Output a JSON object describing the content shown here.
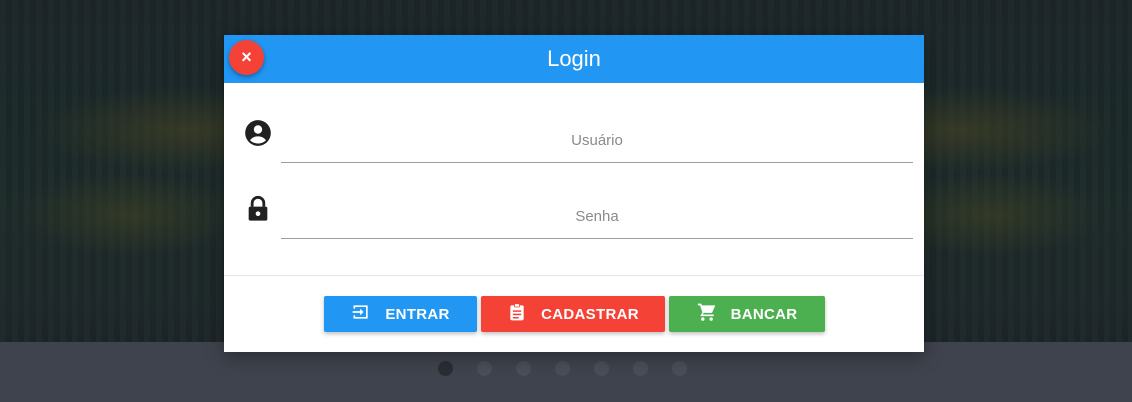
{
  "modal": {
    "title": "Login",
    "close_label": "×",
    "username_placeholder": "Usuário",
    "password_placeholder": "Senha"
  },
  "actions": {
    "entrar_label": "ENTRAR",
    "cadastrar_label": "CADASTRAR",
    "bancar_label": "BANCAR"
  },
  "icons": {
    "user": "account-circle-icon",
    "lock": "lock-icon",
    "entrar": "login-icon",
    "cadastrar": "clipboard-icon",
    "bancar": "cart-icon"
  },
  "colors": {
    "header": "#2196f3",
    "close": "#f44336",
    "entrar": "#2196f3",
    "cadastrar": "#f44336",
    "bancar": "#4caf50"
  }
}
